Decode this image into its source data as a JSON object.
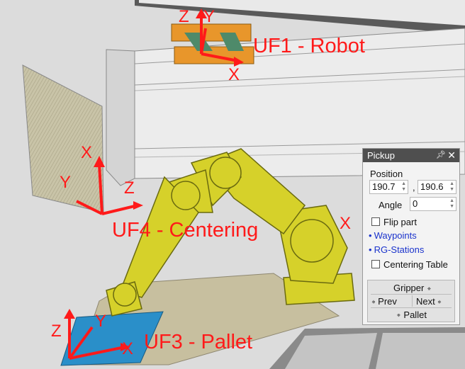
{
  "scene": {
    "frames": [
      {
        "label": "UF1 - Robot",
        "axes": [
          "Z",
          "Y",
          "X"
        ]
      },
      {
        "label": "UF4 - Centering",
        "axes": [
          "X",
          "Y",
          "Z"
        ]
      },
      {
        "label": "UF3 - Pallet",
        "axes": [
          "Z",
          "Y",
          "X"
        ]
      }
    ],
    "robot_axis_x": "X"
  },
  "panel": {
    "title": "Pickup",
    "pin_icon": "pin-icon",
    "close_icon": "close-icon",
    "position_label": "Position",
    "pos_x": "190.7",
    "separator": ",",
    "pos_y": "190.6",
    "angle_label": "Angle",
    "angle_value": "0",
    "flip_label": "Flip part",
    "waypoints_link": "Waypoints",
    "rg_stations_link": "RG-Stations",
    "centering_label": "Centering Table",
    "nav": {
      "gripper": "Gripper",
      "prev": "Prev",
      "next": "Next",
      "pallet": "Pallet"
    }
  },
  "colors": {
    "robot": "#d6d12a",
    "axis": "#ff1a1a",
    "panel_title": "#4f4f4f",
    "link": "#1a33cc"
  }
}
